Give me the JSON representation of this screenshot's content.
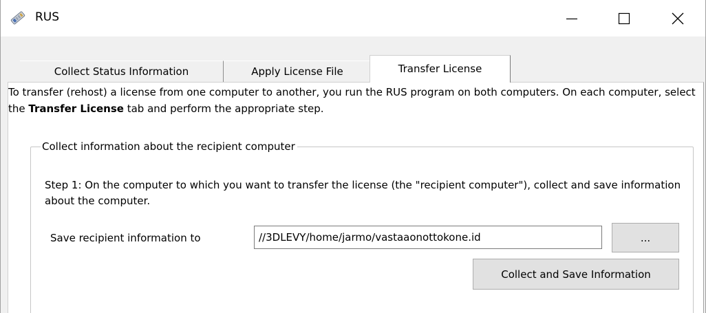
{
  "window": {
    "title": "RUS",
    "icon": "rus-app-icon",
    "controls": {
      "minimize_icon": "minimize-icon",
      "maximize_icon": "maximize-icon",
      "close_icon": "close-icon"
    }
  },
  "tabs": [
    {
      "label": "Collect Status Information",
      "selected": false
    },
    {
      "label": "Apply License File",
      "selected": false
    },
    {
      "label": "Transfer License",
      "selected": true
    }
  ],
  "transfer": {
    "intro_part1": "To transfer (rehost) a license from one computer to another, you run the RUS program on both computers. On each computer, select the ",
    "intro_bold": "Transfer License",
    "intro_part2": " tab and perform the appropriate step.",
    "group_title": "Collect information about the recipient computer",
    "step_text": "Step 1: On the computer to which you want to transfer the license (the \"recipient computer\"), collect and save information about the computer.",
    "save_label": "Save recipient information to",
    "save_path": "//3DLEVY/home/jarmo/vastaaonottokone.id",
    "browse_label": "...",
    "collect_button_label": "Collect and Save Information"
  },
  "colors": {
    "window_bg": "#f0f0f0",
    "tab_page_bg": "#ffffff",
    "button_bg": "#e1e1e1",
    "button_border": "#adadad"
  }
}
